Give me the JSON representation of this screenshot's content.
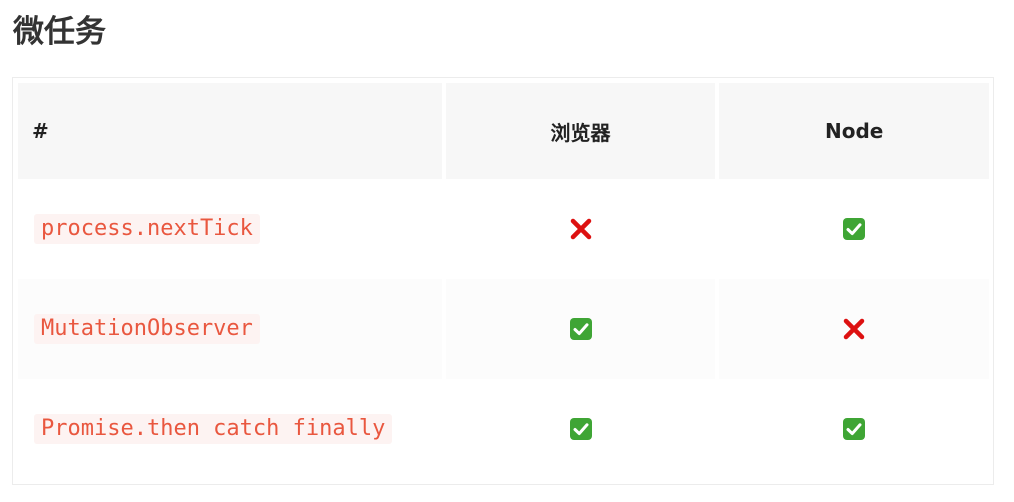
{
  "title": "微任务",
  "table": {
    "headers": [
      "#",
      "浏览器",
      "Node"
    ],
    "rows": [
      {
        "api": "process.nextTick",
        "browser": "no",
        "node": "yes"
      },
      {
        "api": "MutationObserver",
        "browser": "yes",
        "node": "no"
      },
      {
        "api": "Promise.then catch finally",
        "browser": "yes",
        "node": "yes"
      }
    ]
  },
  "icons": {
    "yes": "check-box-icon",
    "no": "cross-icon"
  },
  "colors": {
    "code_text": "#e9573f",
    "code_bg": "#fdf3f2",
    "check_green": "#3fa535",
    "cross_red": "#dd1111",
    "header_bg": "#f7f7f7"
  }
}
